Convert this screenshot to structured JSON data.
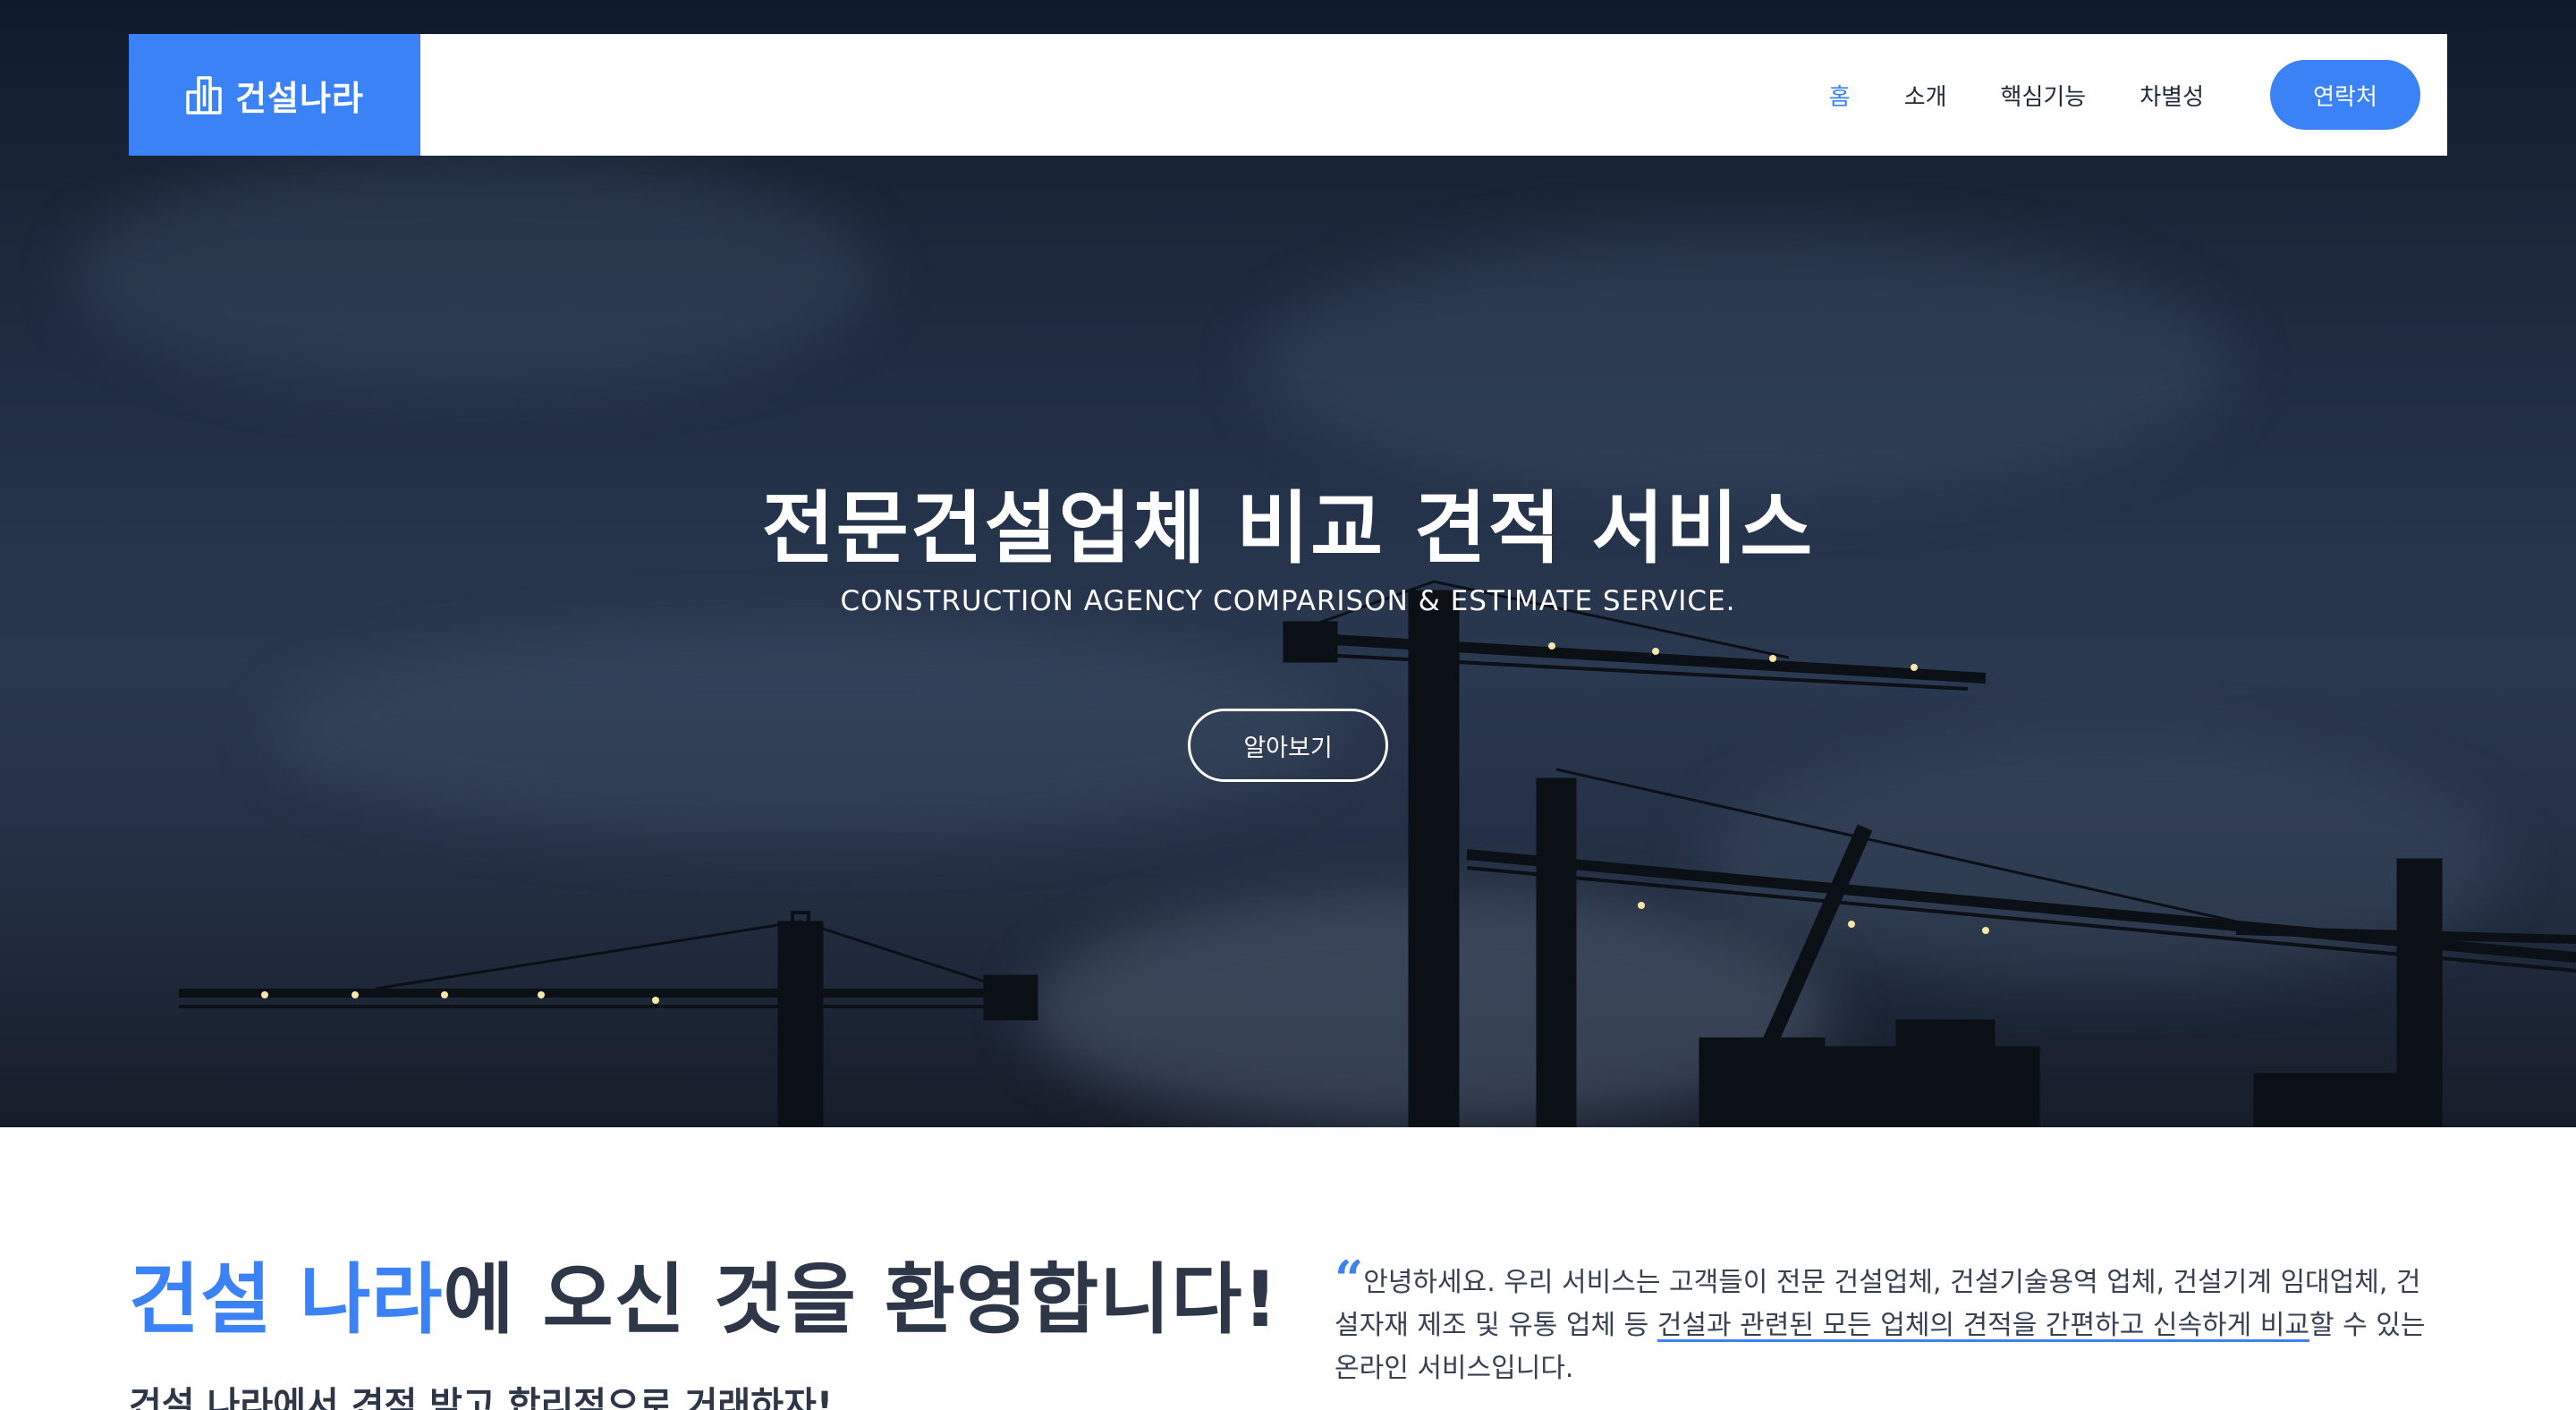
{
  "nav": {
    "brand": "건설나라",
    "links": [
      "홈",
      "소개",
      "핵심기능",
      "차별성"
    ],
    "active_index": 0,
    "contact_label": "연락처"
  },
  "hero": {
    "title": "전문건설업체 비교 견적 서비스",
    "subtitle": "CONSTRUCTION AGENCY COMPARISON & ESTIMATE SERVICE.",
    "button_label": "알아보기"
  },
  "welcome": {
    "title_accent": "건설 나라",
    "title_rest": "에 오신 것을 환영합니다!",
    "subtitle": "건설 나라에서 견적 받고 합리적으로 거래하자!"
  },
  "intro": {
    "quote_mark": "“",
    "text_before": "안녕하세요. 우리 서비스는 고객들이 전문 건설업체, 건설기술용역 업체, 건설기계 임대업체, 건설자재 제조 및 유통 업체 등 ",
    "text_highlight": "건설과 관련된 모든 업체의 견적을 간편하고 신속하게 비교",
    "text_after": "할 수 있는 온라인 서비스입니다."
  },
  "colors": {
    "accent": "#3b82f6",
    "heading": "#2d3748",
    "hero_bg": "#1f2b3e"
  },
  "icons": {
    "brand": "buildings-icon"
  }
}
